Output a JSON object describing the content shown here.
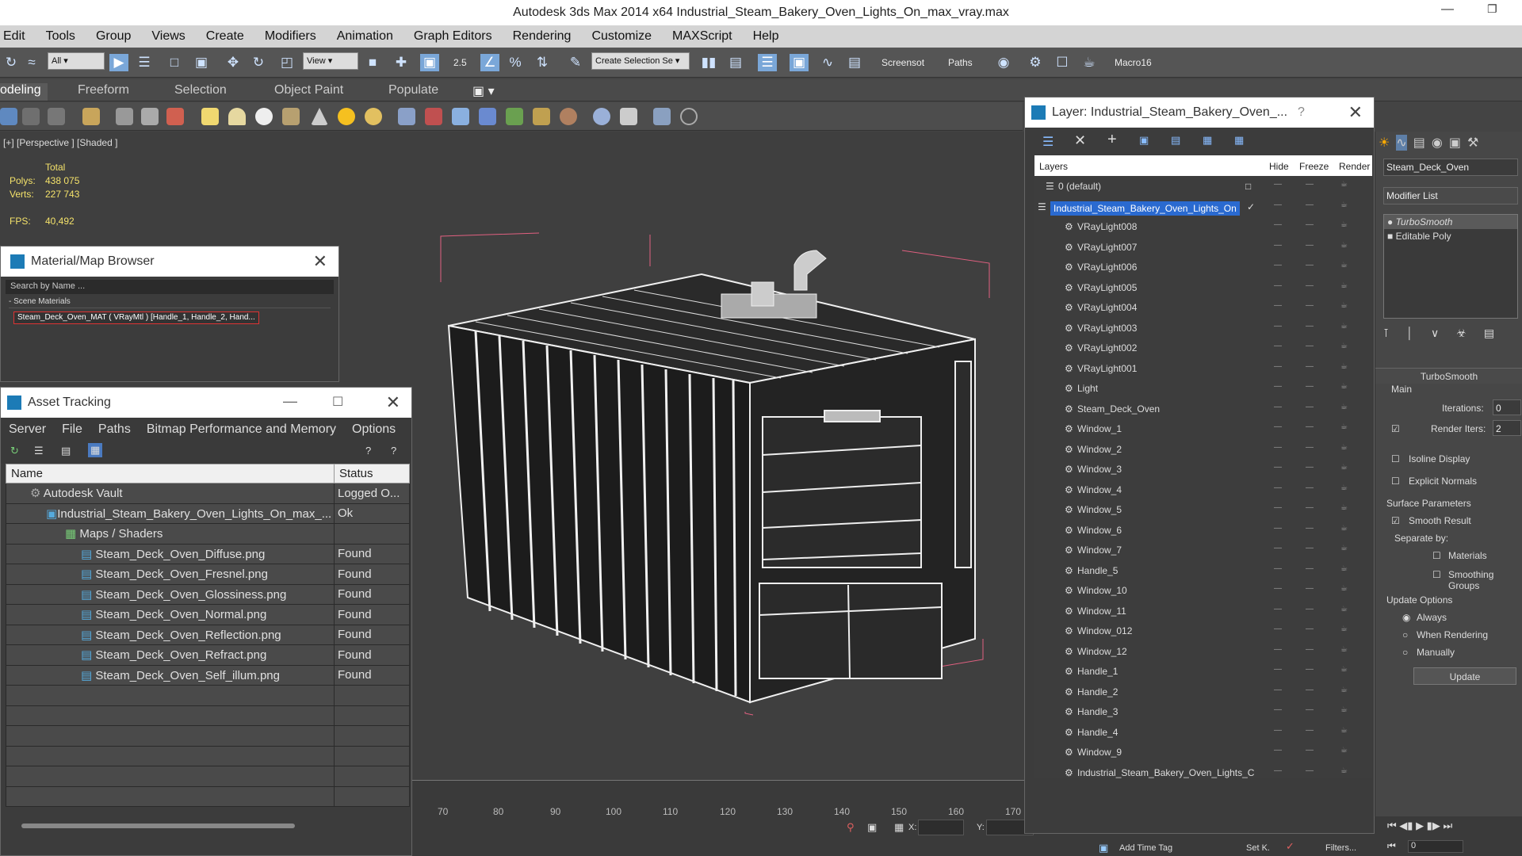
{
  "title_bar": {
    "title": "Autodesk 3ds Max  2014 x64       Industrial_Steam_Bakery_Oven_Lights_On_max_vray.max"
  },
  "menu": [
    "Edit",
    "Tools",
    "Group",
    "Views",
    "Create",
    "Modifiers",
    "Animation",
    "Graph Editors",
    "Rendering",
    "Customize",
    "MAXScript",
    "Help"
  ],
  "toolbar": {
    "filter_value": "All",
    "ref_coord_value": "View",
    "selection_set_placeholder": "Create Selection Se",
    "snap_label": "2.5",
    "screenshot_label": "Screensot",
    "paths_label": "Paths",
    "macro_label": "Macro16"
  },
  "ribbon_tabs": [
    "odeling",
    "Freeform",
    "Selection",
    "Object Paint",
    "Populate"
  ],
  "viewport": {
    "label": "[+] [Perspective ] [Shaded ]",
    "stats": {
      "total_label": "Total",
      "polys_label": "Polys:",
      "polys": "438 075",
      "verts_label": "Verts:",
      "verts": "227 743",
      "fps_label": "FPS:",
      "fps": "40,492"
    }
  },
  "timeline": {
    "ticks": [
      "70",
      "80",
      "90",
      "100",
      "110",
      "120",
      "130",
      "140",
      "150",
      "160",
      "170"
    ]
  },
  "material_browser": {
    "title": "Material/Map Browser",
    "search_placeholder": "Search by Name ...",
    "group_label": "- Scene Materials",
    "item": "Steam_Deck_Oven_MAT ( VRayMtl ) [Handle_1, Handle_2, Hand..."
  },
  "asset_tracking": {
    "title": "Asset Tracking",
    "menu": [
      "Server",
      "File",
      "Paths",
      "Bitmap Performance and Memory",
      "Options"
    ],
    "columns": [
      "Name",
      "Status"
    ],
    "rows": [
      {
        "name": "Autodesk Vault",
        "status": "Logged O..."
      },
      {
        "name": "Industrial_Steam_Bakery_Oven_Lights_On_max_...",
        "status": "Ok"
      },
      {
        "name": "Maps / Shaders",
        "status": ""
      },
      {
        "name": "Steam_Deck_Oven_Diffuse.png",
        "status": "Found"
      },
      {
        "name": "Steam_Deck_Oven_Fresnel.png",
        "status": "Found"
      },
      {
        "name": "Steam_Deck_Oven_Glossiness.png",
        "status": "Found"
      },
      {
        "name": "Steam_Deck_Oven_Normal.png",
        "status": "Found"
      },
      {
        "name": "Steam_Deck_Oven_Reflection.png",
        "status": "Found"
      },
      {
        "name": "Steam_Deck_Oven_Refract.png",
        "status": "Found"
      },
      {
        "name": "Steam_Deck_Oven_Self_illum.png",
        "status": "Found"
      }
    ]
  },
  "layer_panel": {
    "title": "Layer: Industrial_Steam_Bakery_Oven_...",
    "help": "?",
    "columns": [
      "Layers",
      "Hide",
      "Freeze",
      "Render"
    ],
    "layers": [
      "0 (default)",
      "Industrial_Steam_Bakery_Oven_Lights_On",
      "VRayLight008",
      "VRayLight007",
      "VRayLight006",
      "VRayLight005",
      "VRayLight004",
      "VRayLight003",
      "VRayLight002",
      "VRayLight001",
      "Light",
      "Steam_Deck_Oven",
      "Window_1",
      "Window_2",
      "Window_3",
      "Window_4",
      "Window_5",
      "Window_6",
      "Window_7",
      "Handle_5",
      "Window_10",
      "Window_11",
      "Window_012",
      "Window_12",
      "Handle_1",
      "Handle_2",
      "Handle_3",
      "Handle_4",
      "Window_9",
      "Industrial_Steam_Bakery_Oven_Lights_C"
    ]
  },
  "command_panel": {
    "object_name": "Steam_Deck_Oven",
    "modifier_list": "Modifier List",
    "stack": [
      "TurboSmooth",
      "Editable Poly"
    ],
    "rollout_title": "TurboSmooth",
    "main_label": "Main",
    "iterations_label": "Iterations:",
    "iterations": "0",
    "render_iters_label": "Render Iters:",
    "render_iters": "2",
    "isoline": "Isoline Display",
    "explicit_normals": "Explicit Normals",
    "surface_params": "Surface Parameters",
    "smooth_result": "Smooth Result",
    "separate_by": "Separate by:",
    "materials": "Materials",
    "smoothing_groups": "Smoothing Groups",
    "update_options": "Update Options",
    "always": "Always",
    "when_rendering": "When Rendering",
    "manually": "Manually",
    "update_button": "Update"
  },
  "status_bar": {
    "add_time_tag": "Add Time Tag",
    "set_key": "Set K.",
    "filters": "Filters...",
    "x_label": "X:",
    "y_label": "Y:",
    "frame": "0"
  }
}
